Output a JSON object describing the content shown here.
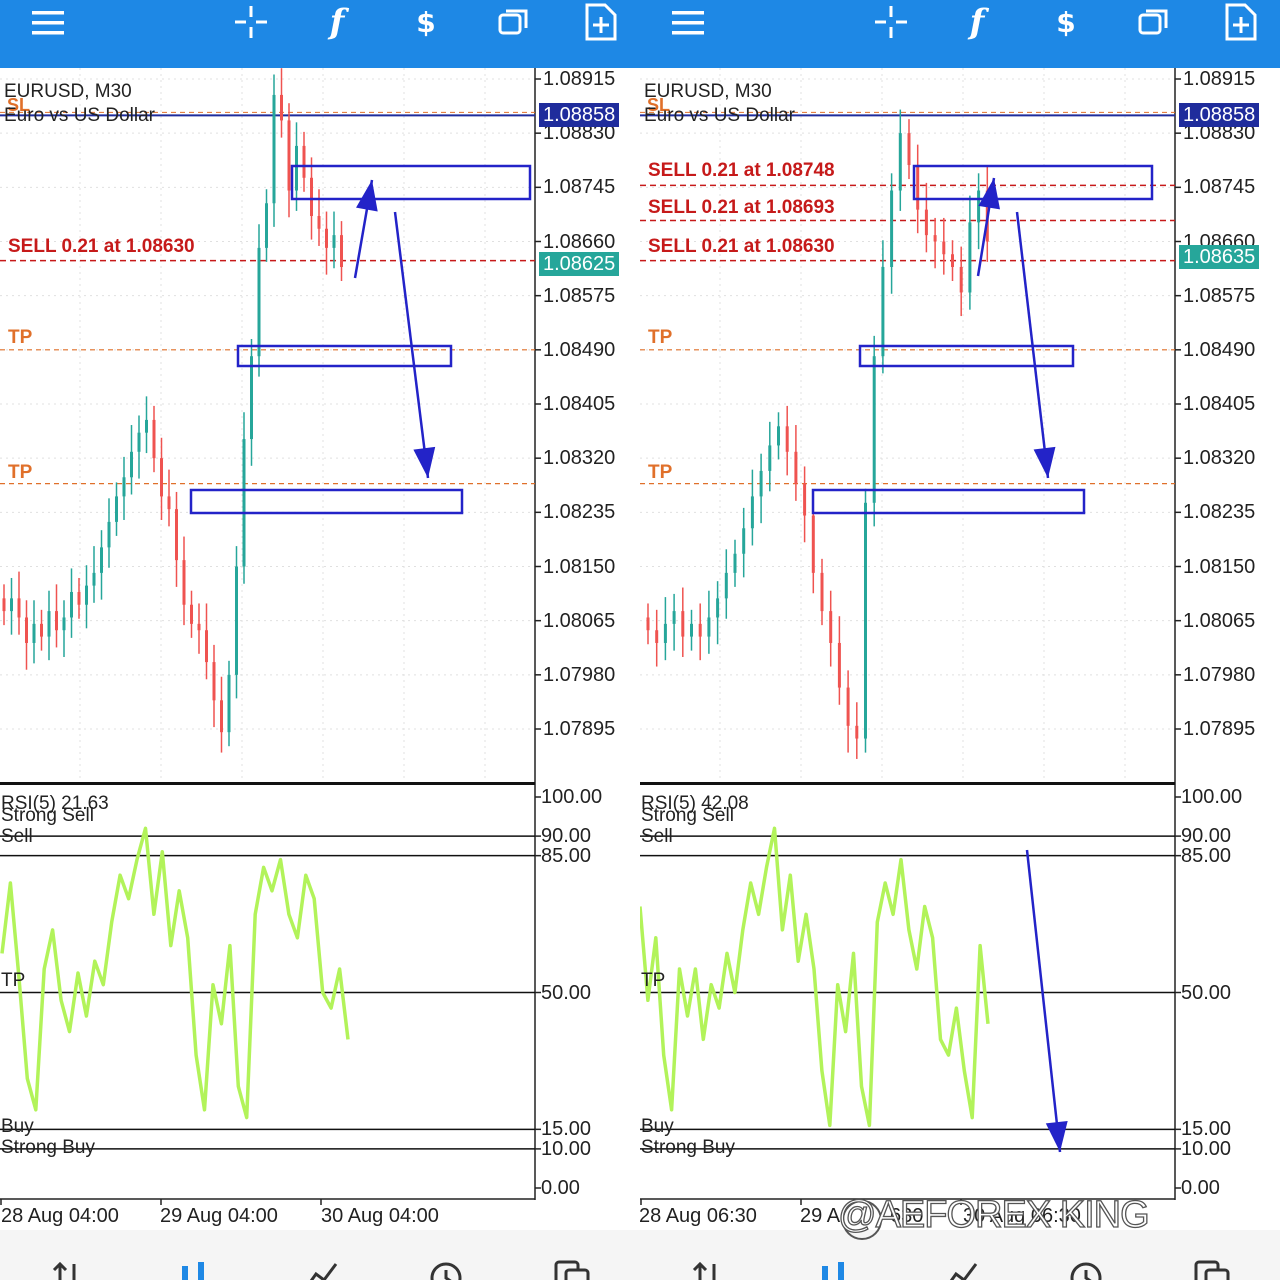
{
  "toolbar_icons": [
    "menu-icon",
    "crosshair-icon",
    "indicators-icon",
    "trade-icon",
    "objects-icon",
    "new-order-icon"
  ],
  "toolbar_text": {
    "indicators": "f",
    "trade": "$"
  },
  "colors": {
    "toolbar": "#1e88e5",
    "bull_candle": "#26a69a",
    "bear_candle": "#ef5350",
    "sell_line": "#c61a1a",
    "tp_line": "#e0702a",
    "annotation": "#2323c8",
    "rsi_line": "#b2f35a",
    "current_price_tag": "#26a69a",
    "ask_price_tag": "#1f2c9c"
  },
  "left": {
    "symbol": "EURUSD, M30",
    "description": "Euro vs US Dollar",
    "sl_label": "SL",
    "orders": [
      "SELL 0.21 at 1.08630"
    ],
    "tp_labels": [
      "TP",
      "TP"
    ],
    "ask_tag": "1.08858",
    "bid_tag": "1.08625",
    "rsi_title": "RSI(5) 21.63",
    "rsi_zone_labels": {
      "strong_sell": "Strong Sell",
      "sell": "Sell",
      "tp": "TP",
      "buy": "Buy",
      "strong_buy": "Strong Buy"
    },
    "dates": [
      "28 Aug 04:00",
      "29 Aug 04:00",
      "30 Aug 04:00"
    ]
  },
  "right": {
    "symbol": "EURUSD, M30",
    "description": "Euro vs US Dollar",
    "sl_label": "SL",
    "orders": [
      "SELL 0.21 at 1.08748",
      "SELL 0.21 at 1.08693",
      "SELL 0.21 at 1.08630"
    ],
    "tp_labels": [
      "TP",
      "TP"
    ],
    "ask_tag": "1.08858",
    "bid_tag": "1.08635",
    "rsi_title": "RSI(5) 42.08",
    "rsi_zone_labels": {
      "strong_sell": "Strong Sell",
      "sell": "Sell",
      "tp": "TP",
      "buy": "Buy",
      "strong_buy": "Strong Buy"
    },
    "dates": [
      "28 Aug 06:30",
      "29 A",
      "630",
      "30 Aug 06:30"
    ]
  },
  "price_axis": [
    "1.08915",
    "1.08830",
    "1.08745",
    "1.08660",
    "1.08575",
    "1.08490",
    "1.08405",
    "1.08320",
    "1.08235",
    "1.08150",
    "1.08065",
    "1.07980",
    "1.07895"
  ],
  "rsi_axis": [
    "100.00",
    "90.00",
    "85.00",
    "50.00",
    "15.00",
    "10.00",
    "0.00"
  ],
  "bottom_tabs": [
    "quotes-icon",
    "chart-icon",
    "trade-icon",
    "history-icon",
    "messages-icon"
  ],
  "watermark": "@AEFOREX KING",
  "chart_data": [
    {
      "type": "candlestick",
      "title": "EURUSD, M30",
      "ylim": [
        1.0785,
        1.0894
      ],
      "price_axis_ticks": [
        1.08915,
        1.0883,
        1.08745,
        1.0866,
        1.08575,
        1.0849,
        1.08405,
        1.0832,
        1.08235,
        1.0815,
        1.08065,
        1.0798,
        1.07895
      ],
      "closes": [
        1.0808,
        1.081,
        1.0807,
        1.0803,
        1.0806,
        1.0804,
        1.0808,
        1.0805,
        1.0807,
        1.0811,
        1.0809,
        1.0812,
        1.0814,
        1.0818,
        1.0822,
        1.0826,
        1.0829,
        1.0833,
        1.0836,
        1.0838,
        1.0832,
        1.0826,
        1.0824,
        1.0816,
        1.0809,
        1.0806,
        1.0805,
        1.08,
        1.0794,
        1.0789,
        1.0798,
        1.0815,
        1.0835,
        1.0848,
        1.0865,
        1.0872,
        1.0889,
        1.0885,
        1.0874,
        1.0881,
        1.0876,
        1.087,
        1.0868,
        1.0865,
        1.0867,
        1.0862
      ],
      "orders": [
        {
          "side": "sell",
          "volume": 0.21,
          "price": 1.0863
        }
      ],
      "take_profit": [
        1.0849,
        1.0828
      ],
      "bid": 1.08625,
      "ask": 1.08858
    },
    {
      "type": "line",
      "title": "RSI(5) 21.63",
      "ylim": [
        0,
        100
      ],
      "levels": [
        90,
        85,
        50,
        15,
        10
      ],
      "values": [
        60,
        78,
        54,
        28,
        20,
        56,
        66,
        48,
        40,
        55,
        44,
        58,
        52,
        68,
        80,
        74,
        84,
        92,
        70,
        86,
        62,
        76,
        64,
        34,
        20,
        52,
        42,
        62,
        26,
        18,
        70,
        82,
        76,
        84,
        70,
        64,
        80,
        74,
        50,
        46,
        56,
        38
      ]
    },
    {
      "type": "candlestick",
      "title": "EURUSD, M30",
      "ylim": [
        1.0785,
        1.0894
      ],
      "price_axis_ticks": [
        1.08915,
        1.0883,
        1.08745,
        1.0866,
        1.08575,
        1.0849,
        1.08405,
        1.0832,
        1.08235,
        1.0815,
        1.08065,
        1.0798,
        1.07895
      ],
      "closes": [
        1.0805,
        1.0803,
        1.0806,
        1.0808,
        1.0804,
        1.0806,
        1.0804,
        1.0807,
        1.081,
        1.0814,
        1.0817,
        1.0821,
        1.0826,
        1.083,
        1.0834,
        1.0837,
        1.0833,
        1.0828,
        1.0823,
        1.0814,
        1.0808,
        1.0803,
        1.0796,
        1.079,
        1.0788,
        1.0825,
        1.0848,
        1.0862,
        1.0874,
        1.0883,
        1.0878,
        1.0871,
        1.0867,
        1.0866,
        1.0864,
        1.0862,
        1.0858,
        1.0869,
        1.0874,
        1.0866
      ],
      "orders": [
        {
          "side": "sell",
          "volume": 0.21,
          "price": 1.08748
        },
        {
          "side": "sell",
          "volume": 0.21,
          "price": 1.08693
        },
        {
          "side": "sell",
          "volume": 0.21,
          "price": 1.0863
        }
      ],
      "take_profit": [
        1.0849,
        1.0828
      ],
      "bid": 1.08635,
      "ask": 1.08858
    },
    {
      "type": "line",
      "title": "RSI(5) 42.08",
      "ylim": [
        0,
        100
      ],
      "levels": [
        90,
        85,
        50,
        15,
        10
      ],
      "values": [
        72,
        48,
        64,
        34,
        20,
        56,
        44,
        56,
        38,
        52,
        46,
        60,
        50,
        66,
        78,
        70,
        82,
        92,
        66,
        80,
        58,
        70,
        56,
        30,
        16,
        52,
        40,
        60,
        26,
        16,
        68,
        78,
        70,
        84,
        66,
        56,
        72,
        64,
        38,
        34,
        46,
        30,
        18,
        62,
        42
      ]
    }
  ]
}
